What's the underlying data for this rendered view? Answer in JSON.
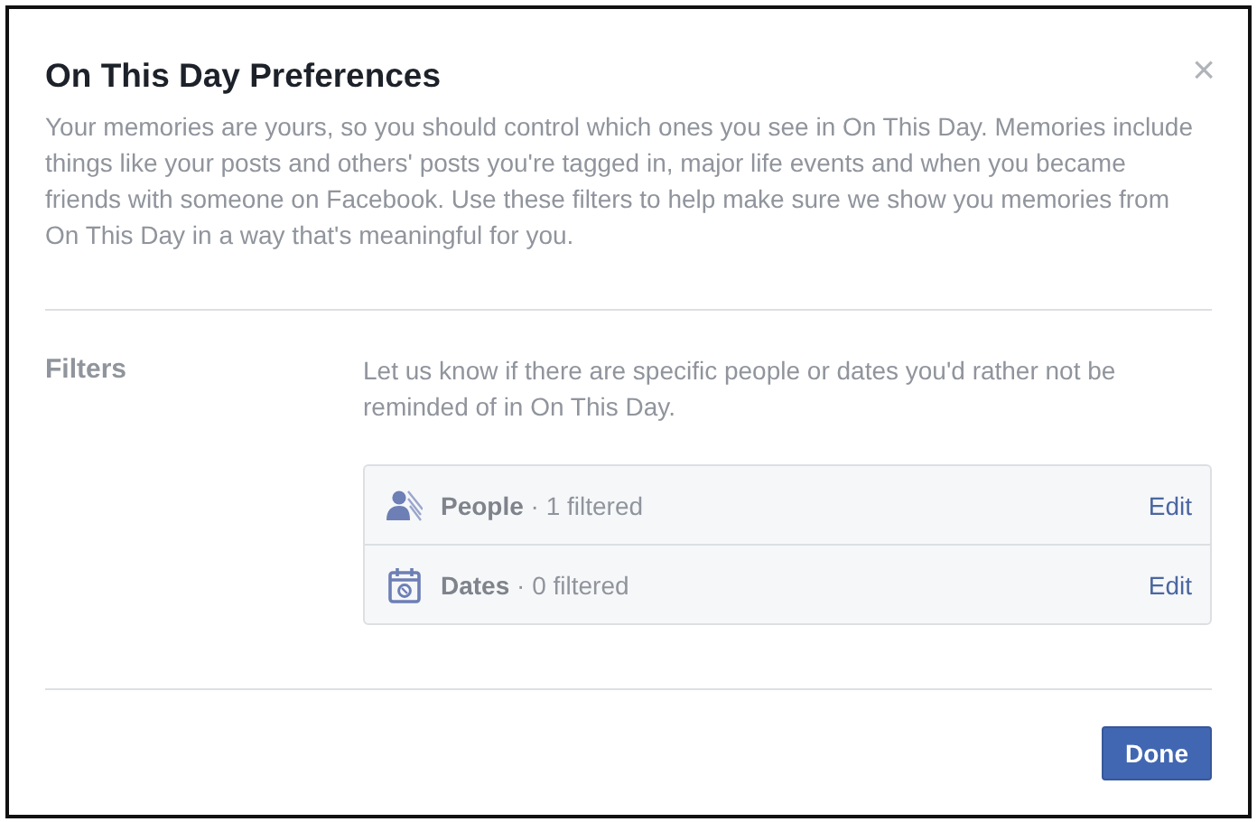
{
  "dialog": {
    "title": "On This Day Preferences",
    "close": "×",
    "description": "Your memories are yours, so you should control which ones you see in On This Day. Memories include things like your posts and others' posts you're tagged in, major life events and when you became friends with someone on Facebook. Use these filters to help make sure we show you memories from On This Day in a way that's meaningful for you."
  },
  "filters": {
    "heading": "Filters",
    "intro": "Let us know if there are specific people or dates you'd rather not be reminded of in On This Day.",
    "items": [
      {
        "kind": "people",
        "label": "People",
        "count": "· 1 filtered",
        "action": "Edit"
      },
      {
        "kind": "dates",
        "label": "Dates",
        "count": "· 0 filtered",
        "action": "Edit"
      }
    ]
  },
  "buttons": [
    "Done"
  ]
}
